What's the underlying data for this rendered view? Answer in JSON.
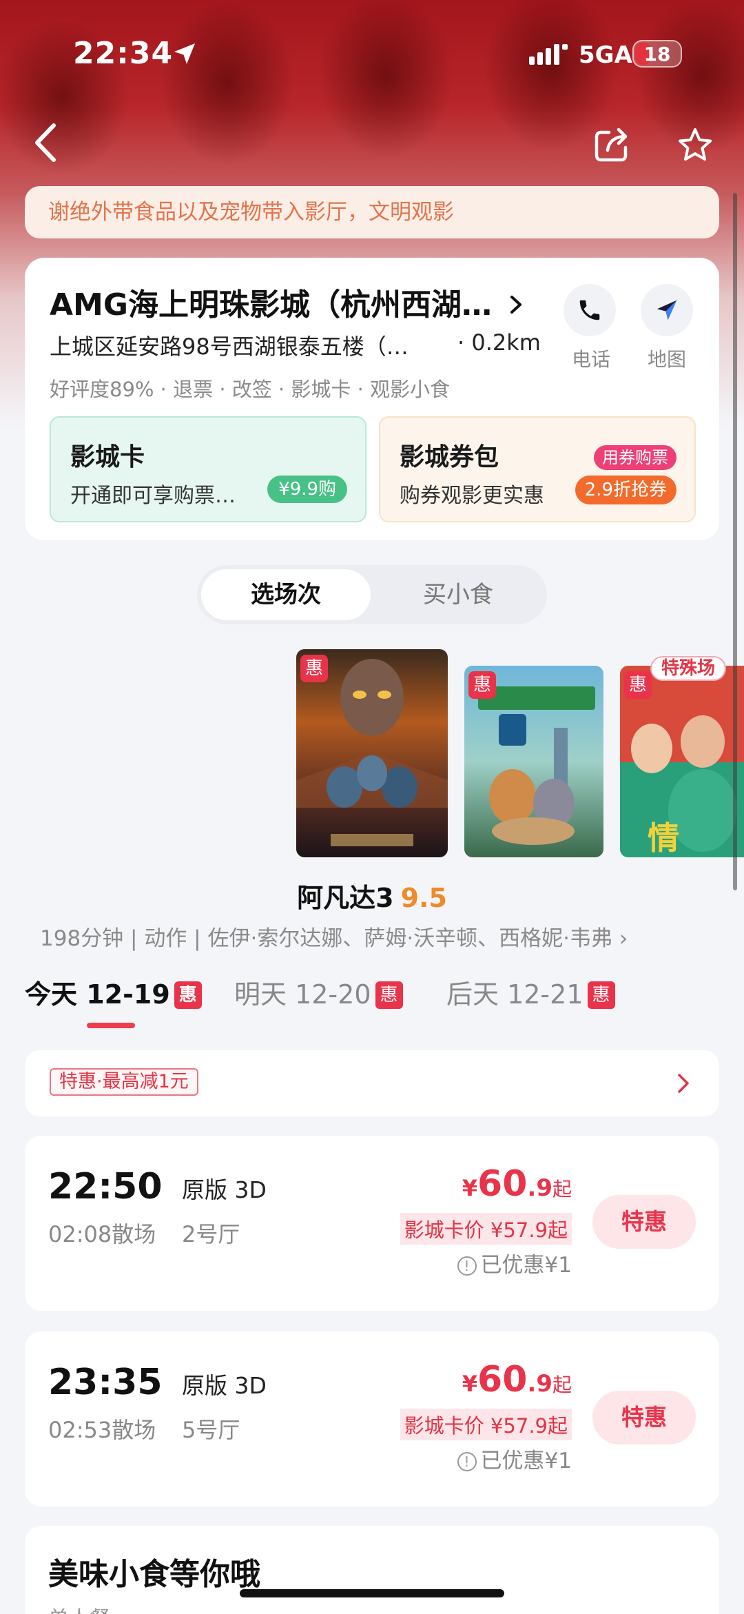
{
  "status_bar": {
    "time": "22:34",
    "network": "5GA",
    "battery": "18"
  },
  "nav": {
    "back_icon": "chevron-left-icon",
    "share_icon": "share-icon",
    "favorite_icon": "star-icon"
  },
  "notice": "谢绝外带食品以及宠物带入影厅，文明观影",
  "cinema": {
    "name": "AMG海上明珠影城（杭州西湖…",
    "address": "上城区延安路98号西湖银泰五楼（…",
    "distance": "· 0.2km",
    "tags": "好评度89% · 退票 · 改签 · 影城卡 · 观影小食",
    "phone_label": "电话",
    "map_label": "地图"
  },
  "promos": {
    "card": {
      "title": "影城卡",
      "subtitle": "开通即可享购票…",
      "pill": "¥9.9购"
    },
    "coupon": {
      "title": "影城券包",
      "subtitle": "购券观影更实惠",
      "badge": "用券购票",
      "pill": "2.9折抢券"
    }
  },
  "segment": {
    "active": "选场次",
    "inactive": "买小食"
  },
  "posters": {
    "badge": "惠",
    "special_tag": "特殊场"
  },
  "movie": {
    "title": "阿凡达3",
    "score": "9.5",
    "info": "198分钟 | 动作 | 佐伊·索尔达娜、萨姆·沃辛顿、西格妮·韦弗 ›"
  },
  "dates": [
    {
      "label": "今天 12-19",
      "badge": "惠"
    },
    {
      "label": "明天 12-20",
      "badge": "惠"
    },
    {
      "label": "后天 12-21",
      "badge": "惠"
    }
  ],
  "discount": {
    "tag": "特惠·最高减1元"
  },
  "showtimes": [
    {
      "time": "22:50",
      "end": "02:08散场",
      "version": "原版 3D",
      "hall": "2号厅",
      "currency": "¥",
      "price_int": "60",
      "price_dec": ".9",
      "price_suffix": "起",
      "card_price": "影城卡价 ¥57.9起",
      "saved": "已优惠¥1",
      "button": "特惠"
    },
    {
      "time": "23:35",
      "end": "02:53散场",
      "version": "原版 3D",
      "hall": "5号厅",
      "currency": "¥",
      "price_int": "60",
      "price_dec": ".9",
      "price_suffix": "起",
      "card_price": "影城卡价 ¥57.9起",
      "saved": "已优惠¥1",
      "button": "特惠"
    }
  ],
  "snacks": {
    "title": "美味小食等你哦",
    "subtitle": "单人餐"
  },
  "colors": {
    "accent": "#e9334a",
    "score": "#ee8a2a",
    "green_pill": "#48c186",
    "orange_pill": "#f36b2c"
  }
}
